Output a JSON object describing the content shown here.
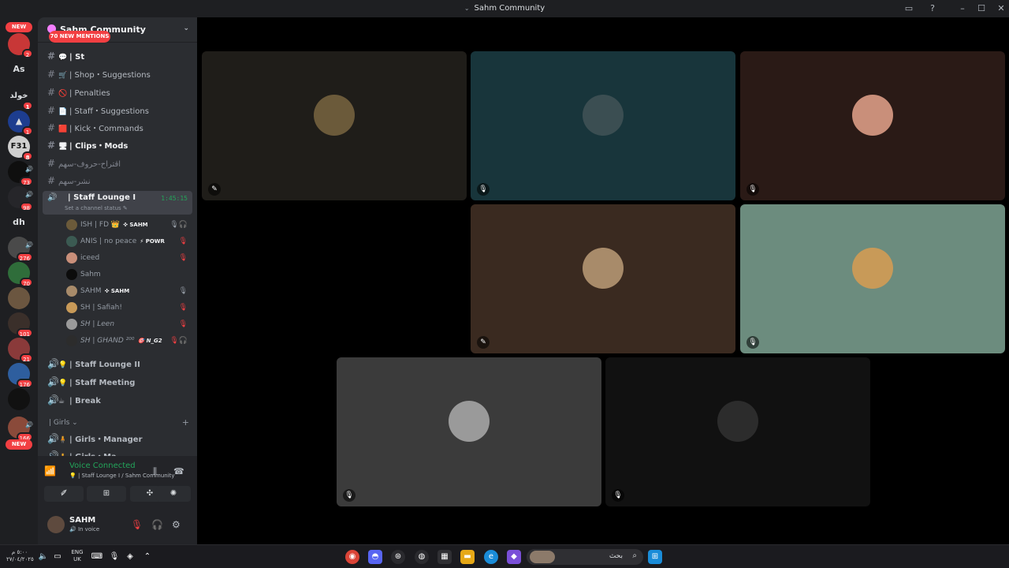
{
  "window": {
    "title": "Sahm Community"
  },
  "servers": {
    "new_top": "NEW",
    "new_bottom": "NEW",
    "items": [
      {
        "label": "",
        "badge": "2"
      },
      {
        "label": "As",
        "badge": ""
      },
      {
        "label": "خولد",
        "badge": "1"
      },
      {
        "label": "",
        "badge": "1"
      },
      {
        "label": "F31",
        "badge": "8"
      },
      {
        "label": "",
        "badge": "73"
      },
      {
        "label": "",
        "badge": "98"
      },
      {
        "label": "dh",
        "badge": ""
      },
      {
        "label": "",
        "badge": "276"
      },
      {
        "label": "",
        "badge": "70"
      },
      {
        "label": "",
        "badge": ""
      },
      {
        "label": "",
        "badge": "101"
      },
      {
        "label": "",
        "badge": "21"
      },
      {
        "label": "",
        "badge": "176"
      },
      {
        "label": "",
        "badge": ""
      },
      {
        "label": "",
        "badge": "166"
      }
    ]
  },
  "guild": {
    "name": "Sahm Community",
    "mentions": "70 NEW MENTIONS"
  },
  "channels": [
    {
      "name": "| St",
      "emoji": "💬",
      "style": "bold"
    },
    {
      "name": "| Shop・Suggestions",
      "emoji": "🛒",
      "style": "semi"
    },
    {
      "name": "| Penalties",
      "emoji": "🚫",
      "style": "semi"
    },
    {
      "name": "| Staff・Suggestions",
      "emoji": "📄",
      "style": "semi"
    },
    {
      "name": "| Kick・Commands",
      "emoji": "🟥",
      "style": "semi"
    },
    {
      "name": "| Clips・Mods",
      "emoji": "🖥",
      "style": "bold"
    },
    {
      "name": "اقتراح-حروف-سهم",
      "emoji": "",
      "style": "muted"
    },
    {
      "name": "نشر-سهم",
      "emoji": "",
      "style": "muted"
    }
  ],
  "active_voice": {
    "name": "| Staff Lounge I",
    "timer": "1:45:15",
    "status": "Set a channel status ✎",
    "users": [
      {
        "name": "ISH | FD 👑",
        "tag": "✜ SAHM",
        "icons": "🎙🎧"
      },
      {
        "name": "ANIS | no peace",
        "tag": "⚡ POWR",
        "icons": "🎙"
      },
      {
        "name": "iceed",
        "tag": "",
        "icons": "🎙"
      },
      {
        "name": "Sahm",
        "tag": "",
        "icons": ""
      },
      {
        "name": "SAHM",
        "tag": "✜ SAHM",
        "icons": "🎙"
      },
      {
        "name": "SH | Safiah!",
        "tag": "",
        "icons": "🎙"
      },
      {
        "name": "SH | Leen",
        "tag": "",
        "icons": "🎙"
      },
      {
        "name": "SH | GHAND ²⁰⁰",
        "tag": "🎯 N_G2",
        "icons": "🎙🎧"
      }
    ]
  },
  "voice_channels": [
    {
      "name": "| Staff Lounge II",
      "emoji": "💡"
    },
    {
      "name": "| Staff Meeting",
      "emoji": "💡"
    },
    {
      "name": "| Break",
      "emoji": "☕"
    }
  ],
  "category": {
    "name": "| Girls ⌄",
    "add": "+"
  },
  "girls_channels": [
    {
      "name": "| Girls・Manager",
      "emoji": "🧍"
    },
    {
      "name": "| Girls・Ma",
      "emoji": "🧍"
    }
  ],
  "voice_panel": {
    "status": "Voice Connected",
    "sub": "💡 | Staff Lounge I / Sahm Community"
  },
  "controls": [
    "✐̸",
    "⊞",
    "✣",
    "✺"
  ],
  "user": {
    "name": "SAHM",
    "status": "In voice"
  },
  "tiles": [
    {
      "color": "#1f1d19",
      "avatar": "#6b5a3a",
      "mic": "✎"
    },
    {
      "color": "#18353b",
      "avatar": "#3b4e52",
      "mic": "🎙"
    },
    {
      "color": "#2a1a16",
      "avatar": "#c98f7a",
      "mic": "🎙"
    },
    {
      "color": "#3a2a20",
      "avatar": "#a88b6a",
      "mic": "✎"
    },
    {
      "color": "#6c8c7e",
      "avatar": "#c89a58",
      "mic": "🎙"
    },
    {
      "color": "#3b3b3b",
      "avatar": "#9a9a9a",
      "mic": "🎙"
    },
    {
      "color": "#111111",
      "avatar": "#2c2c2c",
      "mic": "🎙"
    }
  ],
  "taskbar": {
    "time": "٥:٠٠ م",
    "date": "٢٧/٠٤/٢٠٢٥",
    "lang": "ENG",
    "region": "UK",
    "search": "بحث"
  }
}
